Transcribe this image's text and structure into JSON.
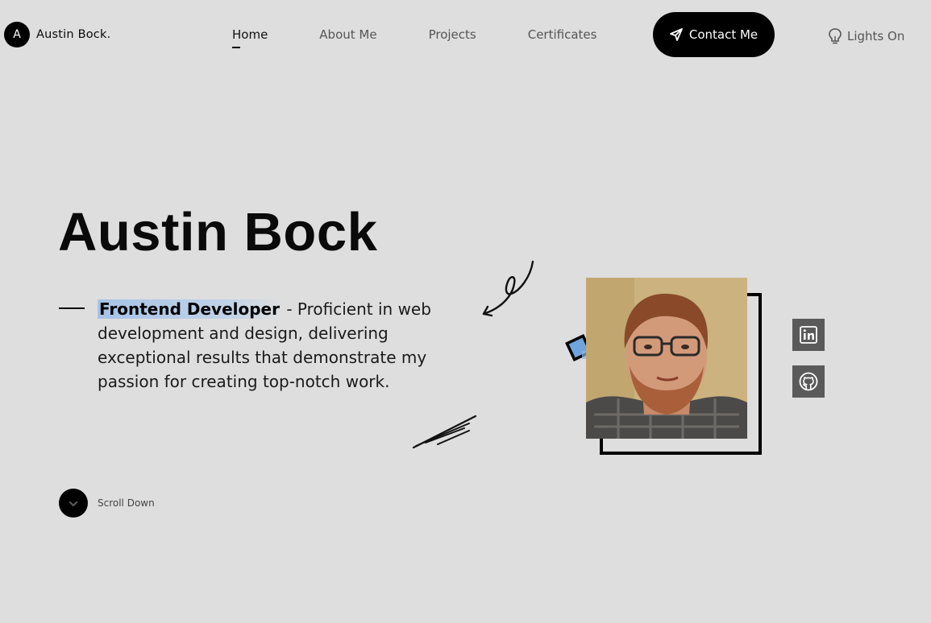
{
  "header": {
    "brand_initial": "A",
    "brand_name": "Austin Bock.",
    "nav": [
      {
        "label": "Home",
        "active": true
      },
      {
        "label": "About Me",
        "active": false
      },
      {
        "label": "Projects",
        "active": false
      },
      {
        "label": "Certificates",
        "active": false
      }
    ],
    "contact_label": "Contact Me",
    "contact_icon": "send-icon",
    "lights_label": "Lights On",
    "lights_icon": "lightbulb-icon"
  },
  "hero": {
    "name": "Austin Bock",
    "role": "Frontend Developer",
    "description": " - Proficient in web development and design, delivering exceptional results that demonstrate my passion for creating top-notch work.",
    "photo_icon": "profile-photo",
    "social": [
      {
        "name": "linkedin",
        "icon": "linkedin-icon"
      },
      {
        "name": "github",
        "icon": "github-icon"
      }
    ],
    "scroll_label": "Scroll Down",
    "scroll_icon": "chevron-down-icon"
  },
  "colors": {
    "background": "#dedede",
    "accent": "#000000",
    "highlight": "#a7c3e6",
    "social_bg": "#5a5a5a",
    "decor_square": "#6fa4dc"
  }
}
